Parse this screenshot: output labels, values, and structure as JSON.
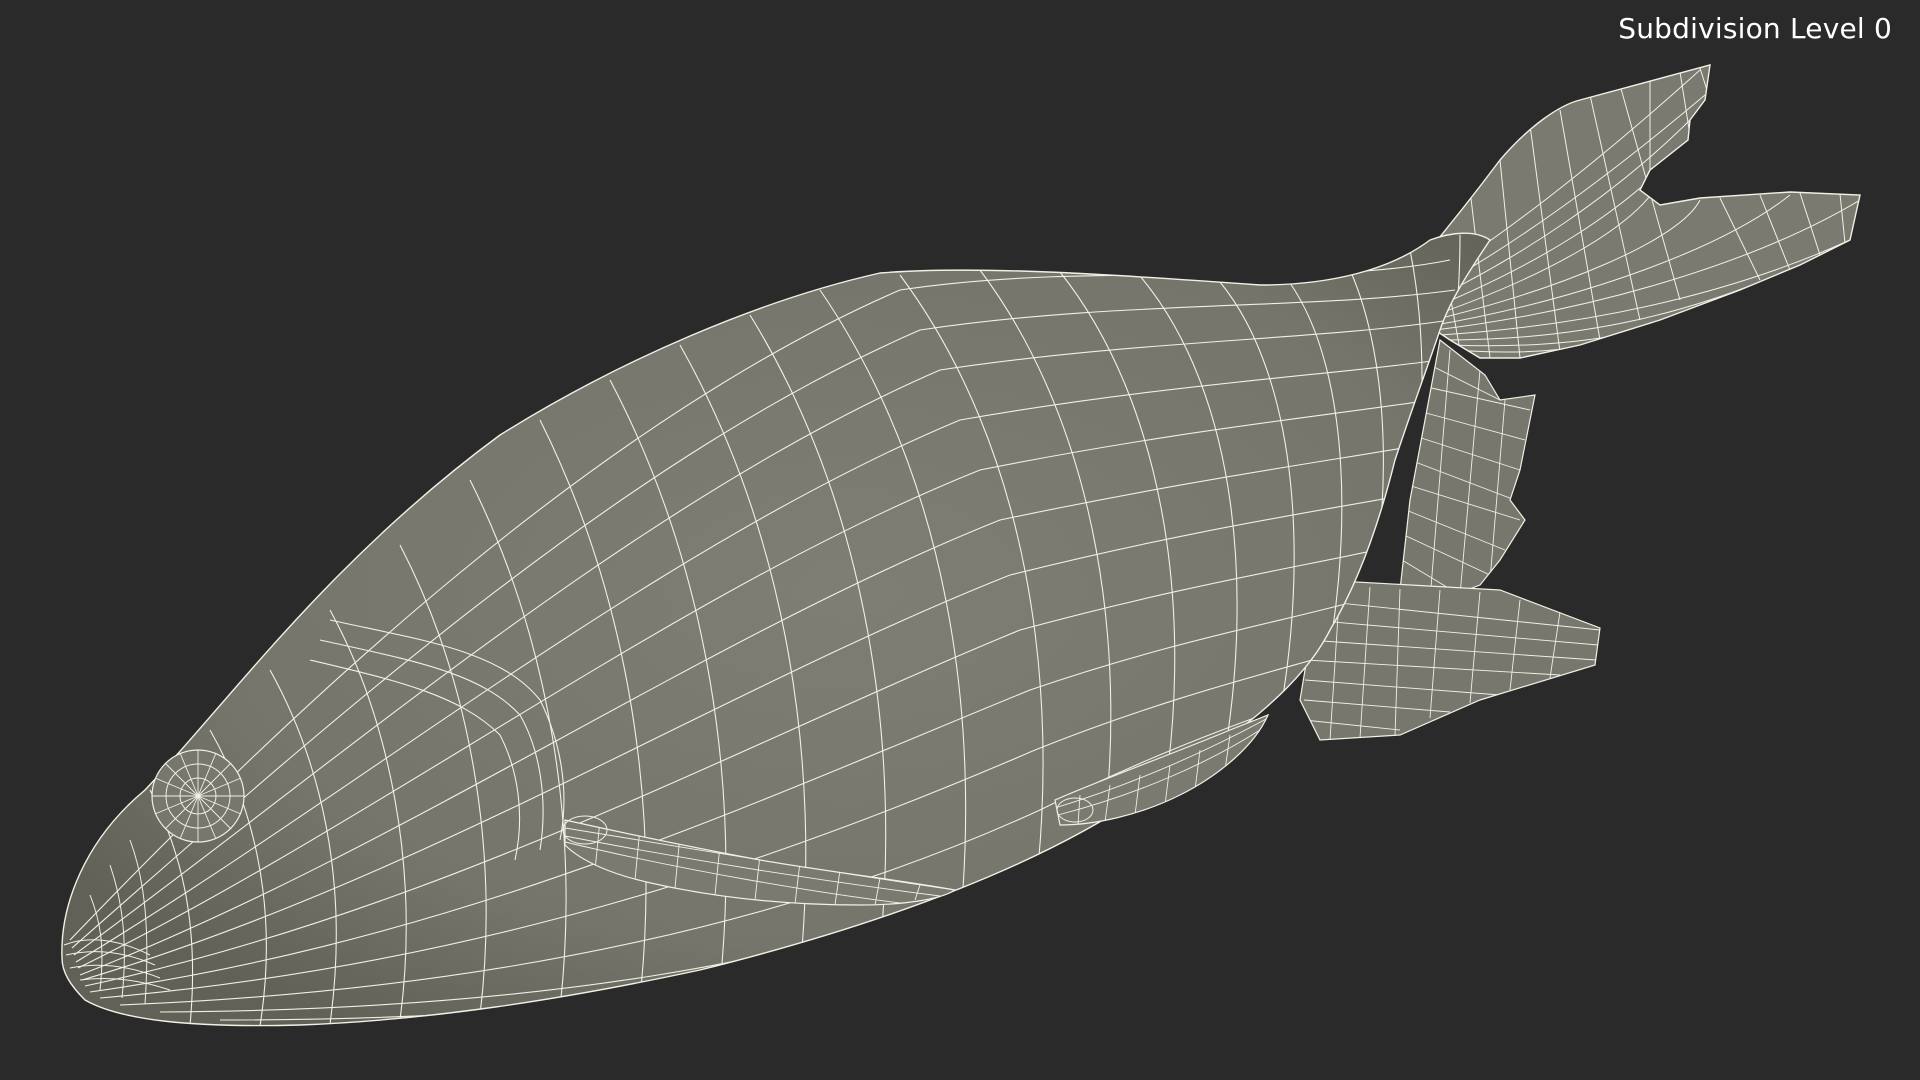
{
  "viewport": {
    "overlay_label": "Subdivision Level 0",
    "background_color": "#2a2a2a",
    "mesh_fill_color": "#7a7a70",
    "wire_color": "#f2f0e6"
  },
  "model": {
    "subject": "fish-wireframe-icon"
  }
}
